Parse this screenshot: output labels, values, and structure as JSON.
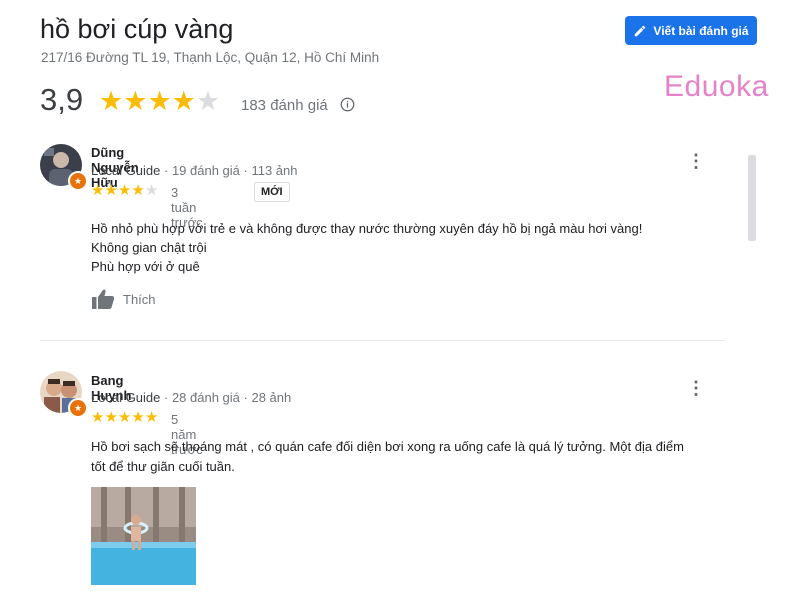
{
  "place": {
    "title": "hồ bơi cúp vàng",
    "address": "217/16 Đường TL 19, Thạnh Lộc, Quận 12, Hồ Chí Minh",
    "write_review_label": "Viết bài đánh giá",
    "rating": "3,9",
    "rating_stars": 4,
    "review_count": "183 đánh giá"
  },
  "watermark": "Eduoka",
  "reviews": [
    {
      "name": "Dũng Nguyễn Hữu",
      "guide": "Local Guide",
      "meta": "· 19 đánh giá · 113 ảnh",
      "stars": 4,
      "time": "3 tuần trước",
      "new_badge": "MỚI",
      "lines": [
        "Hồ nhỏ phù hợp với trẻ e và không được thay nước thường xuyên đáy hồ bị ngả màu hơi vàng!",
        "Không gian chật trội",
        "Phù hợp với ở quê"
      ],
      "like_label": "Thích"
    },
    {
      "name": "Bang Huynh",
      "guide": "Local Guide",
      "meta": "· 28 đánh giá · 28 ảnh",
      "stars": 5,
      "time": "5 năm trước",
      "lines": [
        "Hồ bơi sạch sẽ thoáng mát , có quán cafe đối diện bơi xong ra uống cafe là quá lý tưởng. Một địa điểm",
        "tốt để thư giãn cuối tuần."
      ]
    }
  ],
  "colors": {
    "accent": "#1a73e8",
    "star": "#fbbc04",
    "star_empty": "#dadce0",
    "badge": "#e8710a",
    "watermark": "#e582c9"
  }
}
